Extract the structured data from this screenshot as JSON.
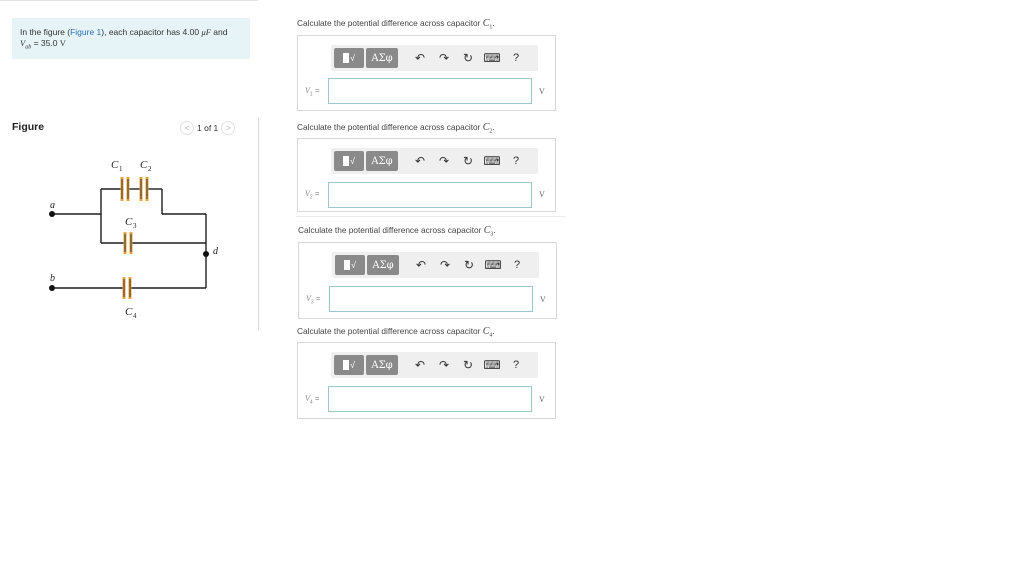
{
  "problem": {
    "prefix": "In the figure (",
    "link": "Figure 1",
    "mid": "), each capacitor has 4.00 ",
    "unit": "μF",
    "suffix": " and",
    "line2_var": "V",
    "line2_sub": "ab",
    "line2_val": " = 35.0 ",
    "line2_unit": "V"
  },
  "figure": {
    "label": "Figure",
    "pager": "1 of 1",
    "prev": "<",
    "next": ">",
    "nodes": {
      "a": "a",
      "b": "b",
      "d": "d"
    },
    "caps": {
      "c1": "C",
      "c1_sub": "1",
      "c2": "C",
      "c2_sub": "2",
      "c3": "C",
      "c3_sub": "3",
      "c4": "C",
      "c4_sub": "4"
    }
  },
  "parts": [
    {
      "prompt": "Calculate the potential difference across capacitor ",
      "cap": "C",
      "cap_sub": "1",
      "end": ".",
      "var": "V",
      "var_sub": "1",
      "eq": " =",
      "unit": "V",
      "value": ""
    },
    {
      "prompt": "Calculate the potential difference across capacitor ",
      "cap": "C",
      "cap_sub": "2",
      "end": ".",
      "var": "V",
      "var_sub": "2",
      "eq": " =",
      "unit": "V",
      "value": ""
    },
    {
      "prompt": "Calculate the potential difference across capacitor ",
      "cap": "C",
      "cap_sub": "3",
      "end": ".",
      "var": "V",
      "var_sub": "3",
      "eq": " =",
      "unit": "V",
      "value": ""
    },
    {
      "prompt": "Calculate the potential difference across capacitor ",
      "cap": "C",
      "cap_sub": "4",
      "end": ".",
      "var": "V",
      "var_sub": "4",
      "eq": " =",
      "unit": "V",
      "value": ""
    }
  ],
  "toolbar": {
    "templates_label": "√",
    "symbols_label": "ΑΣφ",
    "undo": "↶",
    "redo": "↷",
    "reset": "↻",
    "keyboard": "⌨",
    "help": "?"
  }
}
